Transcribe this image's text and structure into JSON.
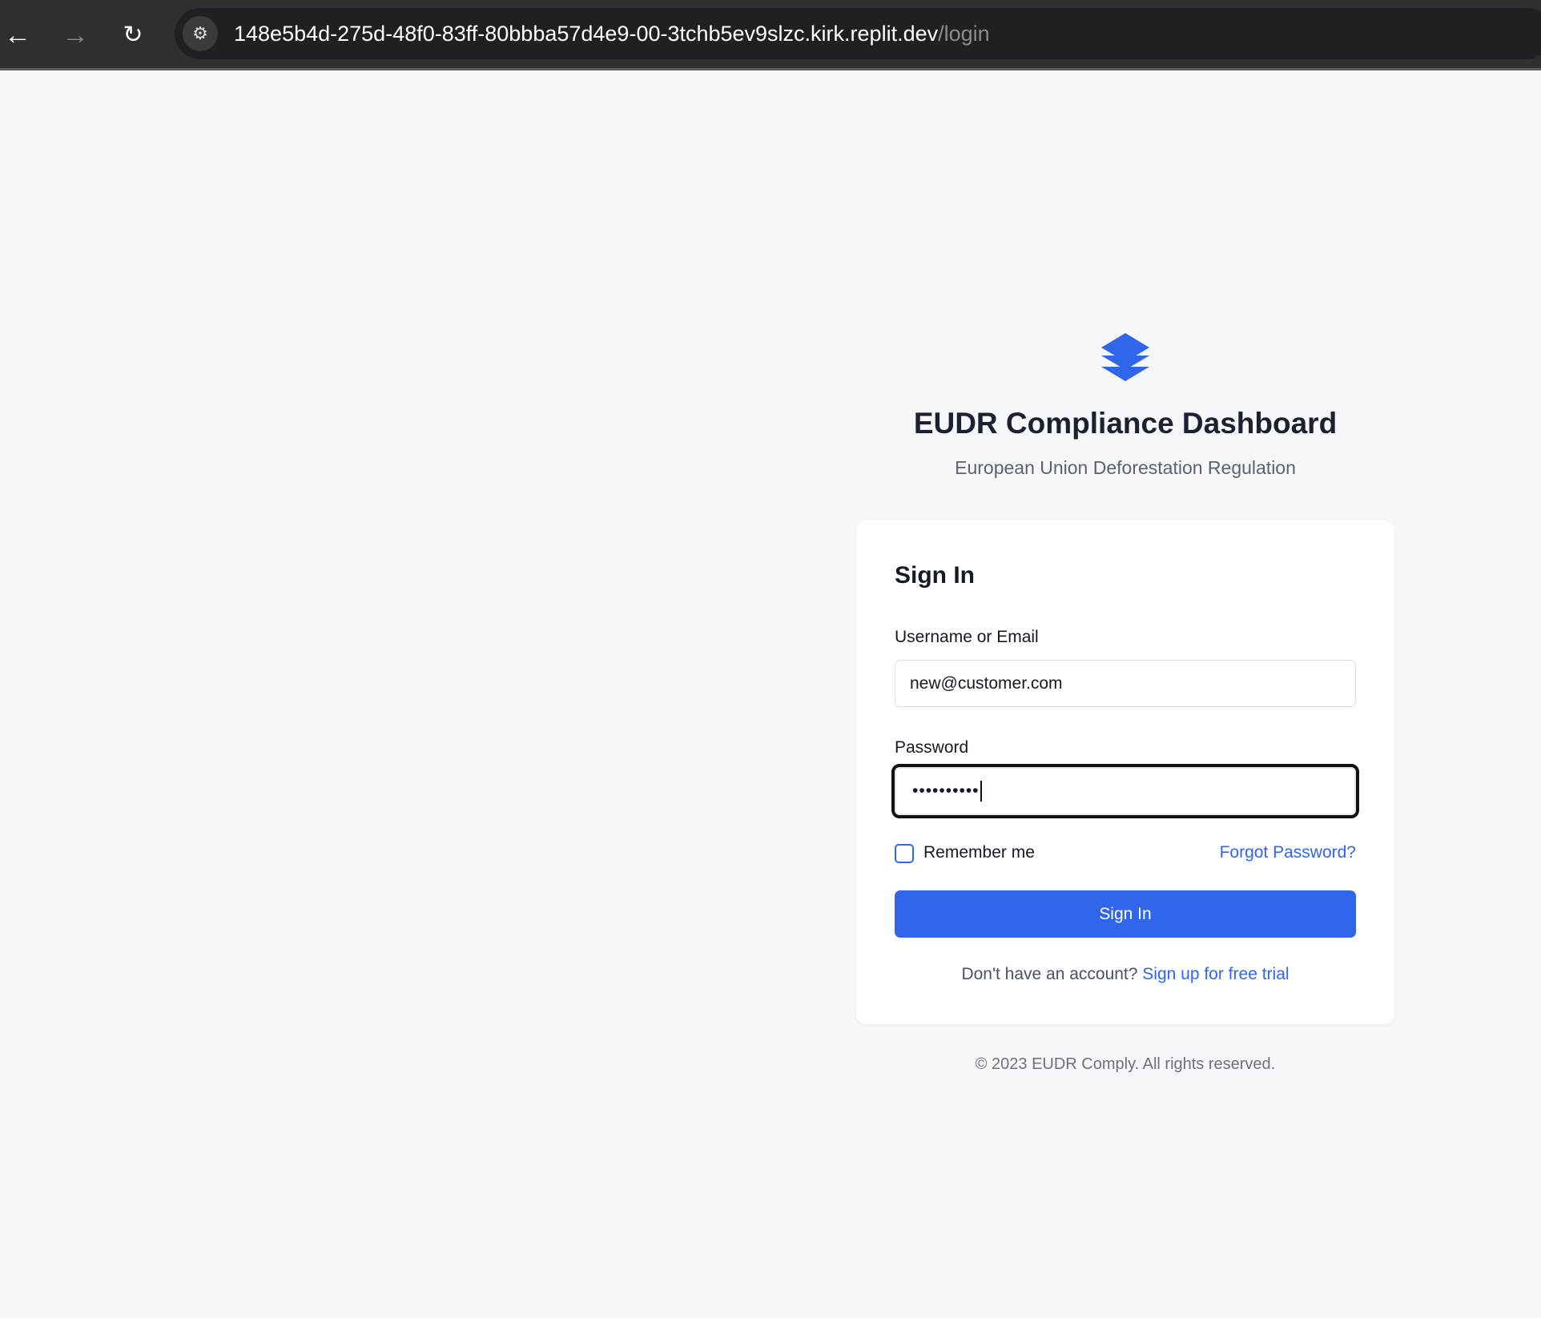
{
  "browser": {
    "back_icon": "arrow-left",
    "forward_icon": "arrow-right",
    "reload_icon": "reload",
    "site_settings_icon": "tune",
    "url_host": "148e5b4d-275d-48f0-83ff-80bbba57d4e9-00-3tchb5ev9slzc.kirk.replit.dev",
    "url_path": "/login"
  },
  "brand": {
    "logo_icon": "layers",
    "title": "EUDR Compliance Dashboard",
    "subtitle": "European Union Deforestation Regulation",
    "accent_color": "#2f66ea"
  },
  "form": {
    "heading": "Sign In",
    "username_label": "Username or Email",
    "username_value": "new@customer.com",
    "password_label": "Password",
    "password_value": "••••••••••",
    "remember_label": "Remember me",
    "remember_checked": false,
    "forgot_link": "Forgot Password?",
    "submit_label": "Sign In",
    "signup_prompt": "Don't have an account?",
    "signup_link": "Sign up for free trial"
  },
  "footer": {
    "copyright": "© 2023 EUDR Comply. All rights reserved."
  }
}
